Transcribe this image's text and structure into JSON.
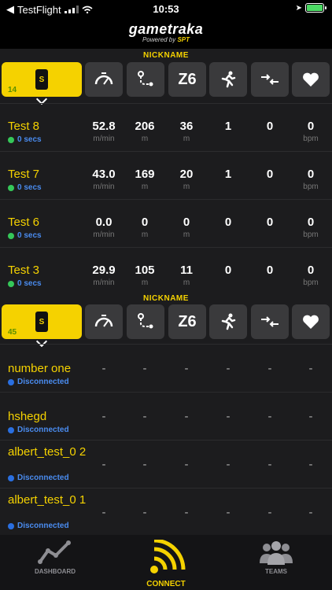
{
  "status": {
    "carrier": "TestFlight",
    "time": "10:53"
  },
  "header": {
    "brand": "gametraka",
    "powered_by": "Powered by",
    "brand_sub": "SPT"
  },
  "section1": {
    "title": "NICKNAME",
    "count": "14"
  },
  "section2": {
    "title": "NICKNAME",
    "count": "45"
  },
  "tabs": {
    "z6": "Z6"
  },
  "live_players": [
    {
      "name": "Test 8",
      "status": "0 secs",
      "values": [
        "52.8",
        "206",
        "36",
        "1",
        "0",
        "0"
      ]
    },
    {
      "name": "Test 7",
      "status": "0 secs",
      "values": [
        "43.0",
        "169",
        "20",
        "1",
        "0",
        "0"
      ]
    },
    {
      "name": "Test 6",
      "status": "0 secs",
      "values": [
        "0.0",
        "0",
        "0",
        "0",
        "0",
        "0"
      ]
    },
    {
      "name": "Test 3",
      "status": "0 secs",
      "values": [
        "29.9",
        "105",
        "11",
        "0",
        "0",
        "0"
      ]
    }
  ],
  "units": [
    "m/min",
    "m",
    "m",
    "",
    "",
    "bpm"
  ],
  "offline_players": [
    {
      "name": "number one",
      "status": "Disconnected",
      "values": [
        "-",
        "-",
        "-",
        "-",
        "-",
        "-"
      ]
    },
    {
      "name": "hshegd",
      "status": "Disconnected",
      "values": [
        "-",
        "-",
        "-",
        "-",
        "-",
        "-"
      ]
    },
    {
      "name": "albert_test_0 2",
      "status": "Disconnected",
      "values": [
        "-",
        "-",
        "-",
        "-",
        "-",
        "-"
      ]
    },
    {
      "name": "albert_test_0 1",
      "status": "Disconnected",
      "values": [
        "-",
        "-",
        "-",
        "-",
        "-",
        "-"
      ]
    }
  ],
  "tabbar": {
    "dashboard": "DASHBOARD",
    "connect": "CONNECT",
    "teams": "TEAMS"
  },
  "colors": {
    "accent": "#f5d200",
    "background": "#1c1c1e",
    "connected": "#35c759",
    "disconnected": "#2a6fe0"
  }
}
